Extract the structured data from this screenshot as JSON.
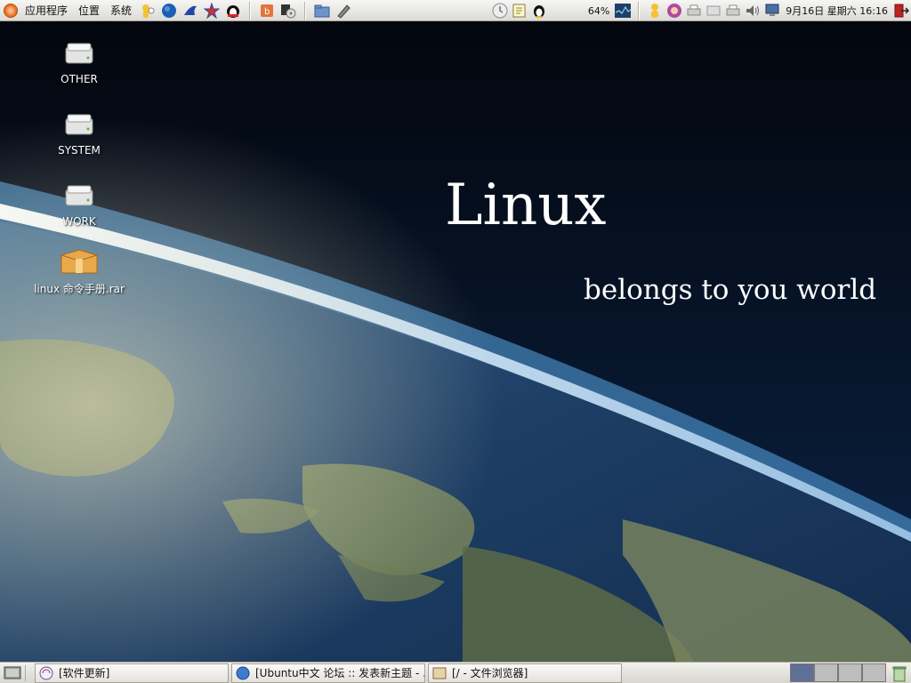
{
  "wallpaper": {
    "title": "Linux",
    "subtitle": "belongs to you world"
  },
  "top_panel": {
    "menus": [
      "应用程序",
      "位置",
      "系统"
    ],
    "launchers": [
      "buddy-icon",
      "globe-icon",
      "bird-icon",
      "star-icon",
      "penguin-chat-icon",
      "ubuntu-box-icon",
      "media-player-icon",
      "folder-icon",
      "pen-tool-icon"
    ],
    "tray": {
      "cpu_percent": "64%",
      "datetime": "9月16日 星期六 16:16"
    }
  },
  "desktop_icons": [
    {
      "label": "OTHER",
      "icon": "drive-icon"
    },
    {
      "label": "SYSTEM",
      "icon": "drive-icon"
    },
    {
      "label": "WORK",
      "icon": "drive-icon"
    },
    {
      "label": "linux 命令手册.rar",
      "icon": "archive-box-icon"
    }
  ],
  "taskbar": {
    "tasks": [
      {
        "label": "[软件更新]",
        "icon": "update-icon"
      },
      {
        "label": "[Ubuntu中文 论坛 :: 发表新主题 - ...",
        "icon": "globe-icon"
      },
      {
        "label": "[/ - 文件浏览器]",
        "icon": "file-browser-icon"
      }
    ],
    "workspaces": 4
  },
  "colors": {
    "panel": "#dcdad5",
    "active_workspace": "#5f6f95",
    "workspace": "#bdbdbd"
  }
}
